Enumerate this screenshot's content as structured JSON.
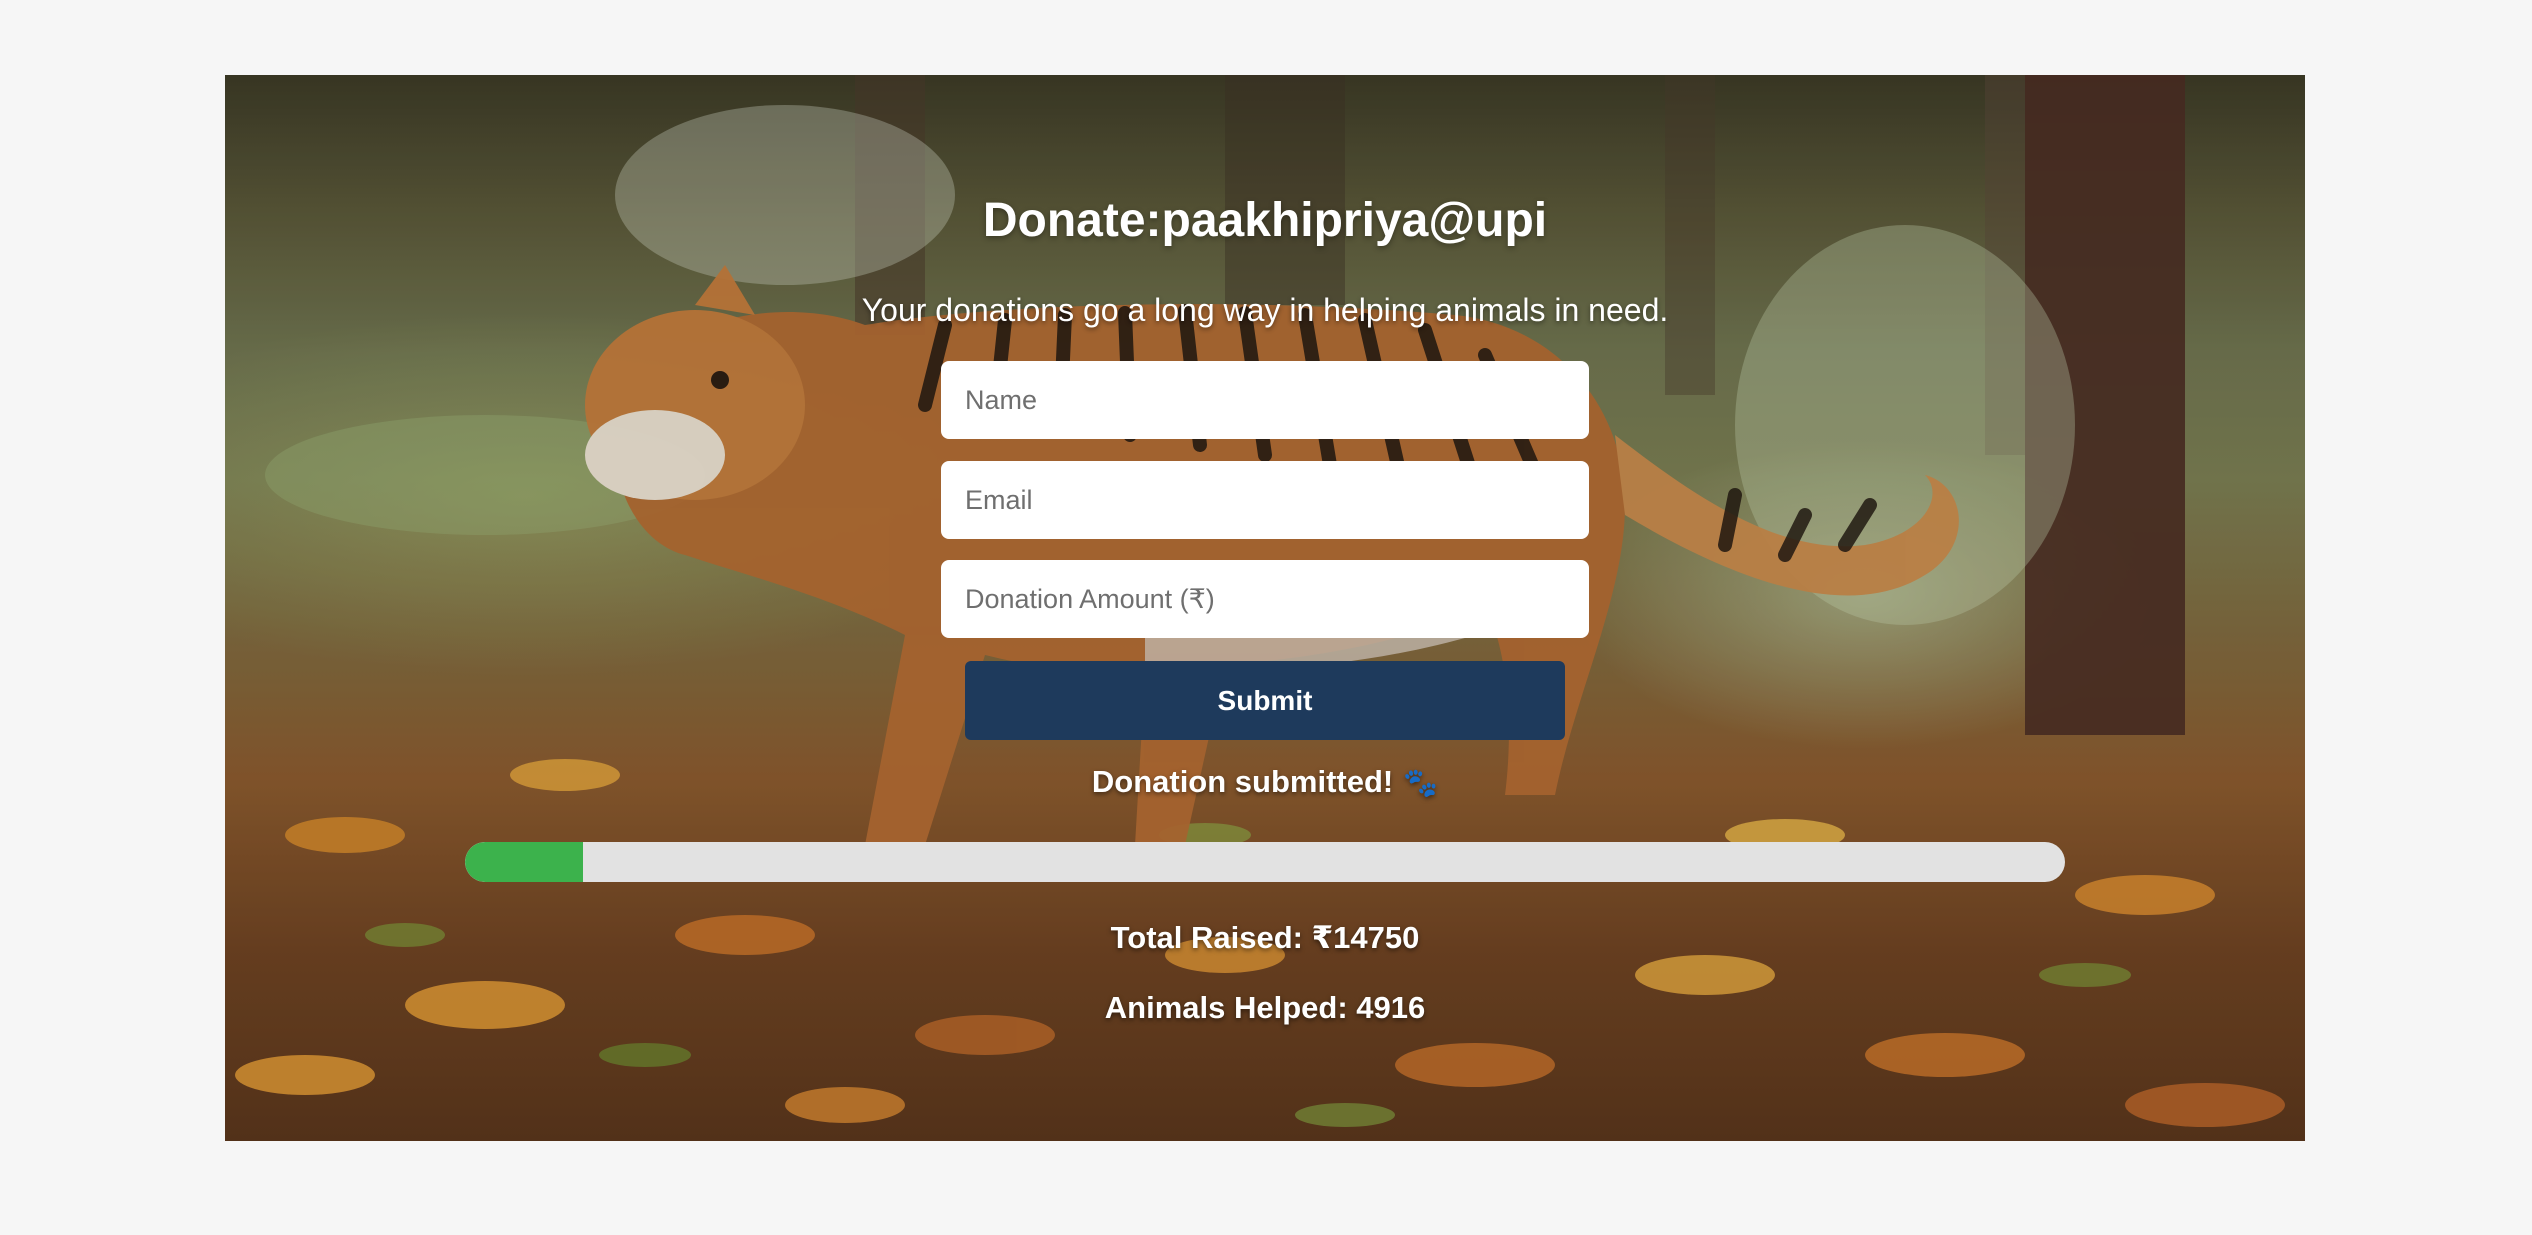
{
  "title": "Donate:paakhipriya@upi",
  "subtitle": "Your donations go a long way in helping animals in need.",
  "form": {
    "name_placeholder": "Name",
    "email_placeholder": "Email",
    "amount_placeholder": "Donation Amount (₹)",
    "submit_label": "Submit"
  },
  "status_message": "Donation submitted!",
  "status_icon": "paw-prints-icon",
  "status_glyph": "🐾",
  "progress": {
    "fraction": 0.074,
    "fill_color": "#3cb24c",
    "track_color": "#e2e2e2"
  },
  "stats": {
    "total_raised": "Total Raised: ₹14750",
    "animals_helped": "Animals Helped: 4916"
  },
  "colors": {
    "button": "#1e3a5c",
    "page_background": "#f6f6f6"
  }
}
